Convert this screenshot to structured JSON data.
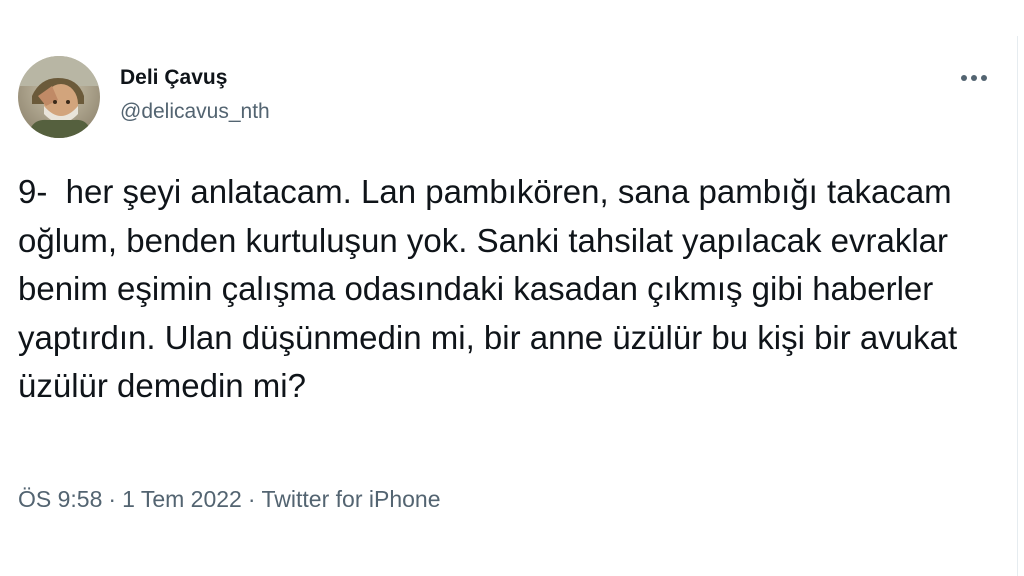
{
  "author": {
    "display_name": "Deli Çavuş",
    "handle": "@delicavus_nth",
    "avatar_icon": "profile-photo"
  },
  "more_icon": "more-options-icon",
  "tweet": {
    "text": "9-  her şeyi anlatacam. Lan pambıkören, sana pambığı takacam oğlum, benden kurtuluşun yok. Sanki tahsilat yapılacak evraklar benim eşimin çalışma odasındaki kasadan çıkmış gibi haberler yaptırdın. Ulan düşünmedin mi, bir anne üzülür bu kişi bir avukat üzülür demedin mi?"
  },
  "meta": {
    "time": "ÖS 9:58",
    "separator": "·",
    "date": "1 Tem 2022",
    "source": "Twitter for iPhone"
  },
  "colors": {
    "text_primary": "#0f1419",
    "text_secondary": "#536471",
    "background": "#ffffff"
  }
}
